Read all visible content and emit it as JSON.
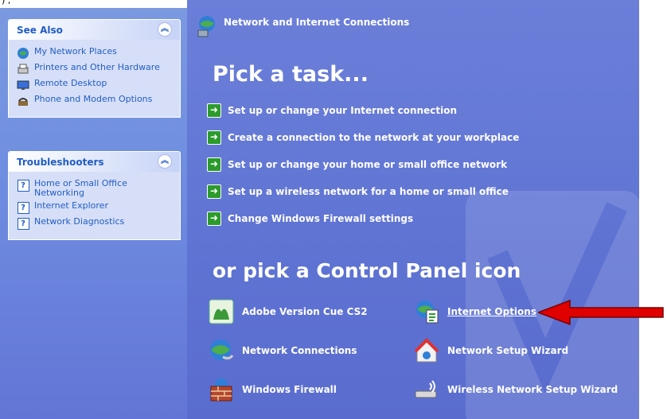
{
  "top_fragment": ") ,",
  "see_also": {
    "title": "See Also",
    "items": [
      {
        "label": "My Network Places",
        "icon": "network-places-icon"
      },
      {
        "label": "Printers and Other Hardware",
        "icon": "printer-icon"
      },
      {
        "label": "Remote Desktop",
        "icon": "remote-desktop-icon"
      },
      {
        "label": "Phone and Modem Options",
        "icon": "phone-icon"
      }
    ]
  },
  "troubleshooters": {
    "title": "Troubleshooters",
    "items": [
      {
        "label": "Home or Small Office Networking",
        "icon": "help-icon"
      },
      {
        "label": "Internet Explorer",
        "icon": "help-icon"
      },
      {
        "label": "Network Diagnostics",
        "icon": "help-icon"
      }
    ]
  },
  "main": {
    "header": "Network and Internet Connections",
    "pick_task": "Pick a task...",
    "tasks": [
      "Set up or change your Internet connection",
      "Create a connection to the network at your workplace",
      "Set up or change your home or small office network",
      "Set up a wireless network for a home or small office",
      "Change Windows Firewall settings"
    ],
    "pick_icon": "or pick a Control Panel icon",
    "icons": [
      {
        "label": "Adobe Version Cue CS2",
        "icon": "adobe-version-cue-icon"
      },
      {
        "label": "Internet Options",
        "icon": "internet-options-icon"
      },
      {
        "label": "Network Connections",
        "icon": "network-connections-icon"
      },
      {
        "label": "Network Setup Wizard",
        "icon": "network-setup-wizard-icon"
      },
      {
        "label": "Windows Firewall",
        "icon": "windows-firewall-icon"
      },
      {
        "label": "Wireless Network Setup Wizard",
        "icon": "wireless-wizard-icon"
      }
    ]
  },
  "colors": {
    "left_pane": "#6f8ee0",
    "main_pane": "#6375d6",
    "panel_title": "#215dc6",
    "task_arrow": "#2c9b2c",
    "annotation_arrow": "#e00000"
  }
}
